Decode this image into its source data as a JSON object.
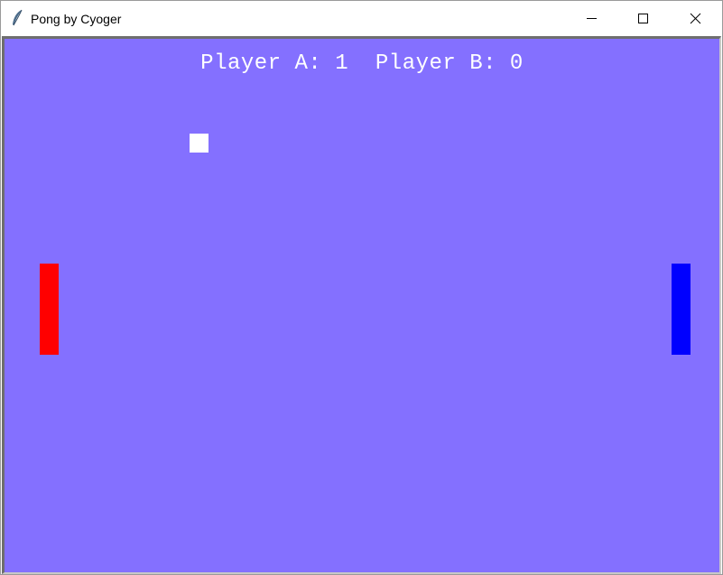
{
  "window": {
    "title": "Pong by Cyoger",
    "icon": "feather-icon",
    "controls": [
      "minimize-icon",
      "maximize-icon",
      "close-icon"
    ]
  },
  "game": {
    "background_color": "#8470ff",
    "score_text": "Player A: 1  Player B: 0",
    "player_a": {
      "label": "Player A",
      "score": 1,
      "paddle_color": "#ff0000"
    },
    "player_b": {
      "label": "Player B",
      "score": 0,
      "paddle_color": "#0000ff"
    },
    "ball_color": "#ffffff"
  }
}
